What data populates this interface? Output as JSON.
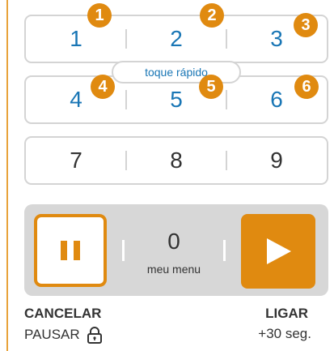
{
  "keypad": {
    "rows": [
      {
        "keys": [
          "1",
          "2",
          "3"
        ]
      },
      {
        "keys": [
          "4",
          "5",
          "6"
        ]
      },
      {
        "keys": [
          "7",
          "8",
          "9"
        ]
      }
    ],
    "quick_touch_label": "toque rápido",
    "badges": [
      "1",
      "2",
      "3",
      "4",
      "5",
      "6"
    ]
  },
  "control_panel": {
    "menu_value": "0",
    "menu_label": "meu menu"
  },
  "labels": {
    "cancel": "CANCELAR",
    "pause": "PAUSAR",
    "start": "LIGAR",
    "add30": "+30 seg."
  },
  "colors": {
    "accent": "#e08a10",
    "key_blue": "#1976b5",
    "key_dark": "#333333",
    "border": "#d4d4d4",
    "panel_bg": "#d7d7d7"
  },
  "icons": {
    "pause": "pause-icon",
    "play": "play-icon",
    "lock": "lock-icon"
  }
}
